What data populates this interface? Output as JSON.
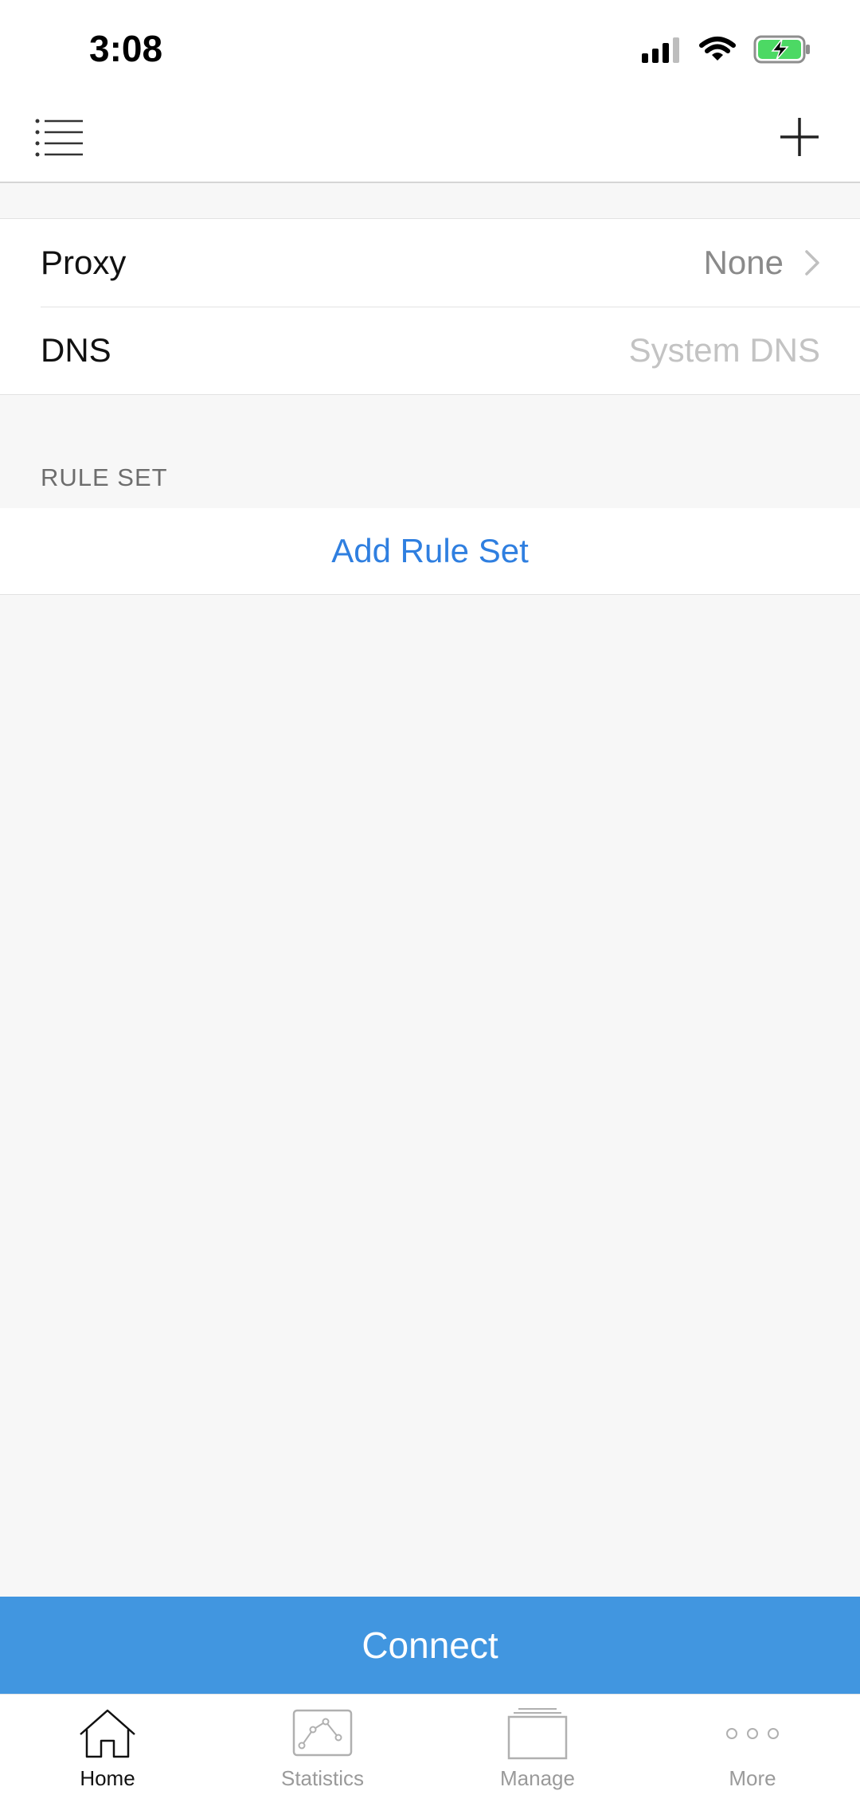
{
  "status_bar": {
    "time": "3:08"
  },
  "settings": {
    "proxy": {
      "label": "Proxy",
      "value": "None"
    },
    "dns": {
      "label": "DNS",
      "value": "System DNS"
    }
  },
  "rule_set": {
    "header": "RULE SET",
    "add_label": "Add Rule Set"
  },
  "connect": {
    "label": "Connect"
  },
  "tabs": [
    {
      "label": "Home",
      "icon": "home-icon",
      "active": true
    },
    {
      "label": "Statistics",
      "icon": "statistics-icon",
      "active": false
    },
    {
      "label": "Manage",
      "icon": "manage-icon",
      "active": false
    },
    {
      "label": "More",
      "icon": "more-icon",
      "active": false
    }
  ],
  "colors": {
    "accent": "#2f7fe0",
    "connect_bg": "#4196e0",
    "battery": "#4cd964"
  }
}
